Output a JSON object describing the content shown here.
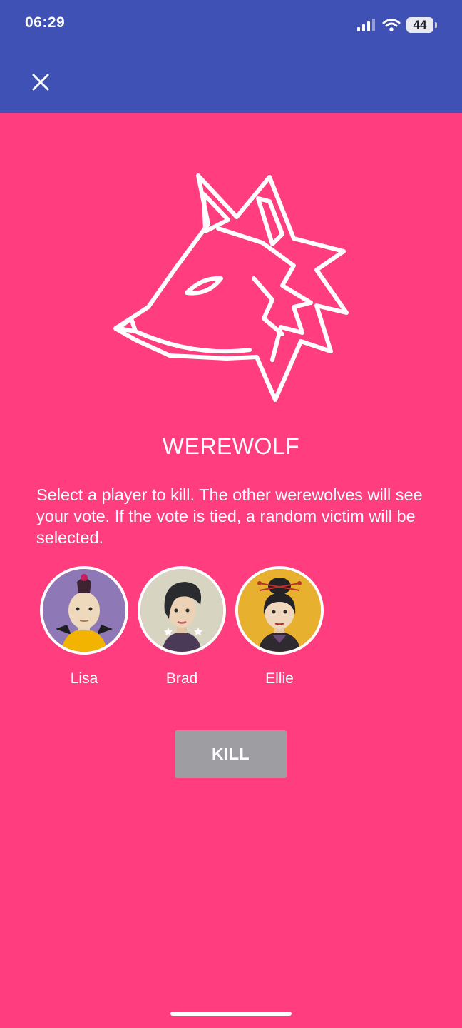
{
  "status_bar": {
    "time": "06:29",
    "battery": "44"
  },
  "header": {
    "close_icon": "close-icon"
  },
  "role": {
    "icon": "wolf-head-icon",
    "title": "WEREWOLF",
    "instructions": "Select a player to kill. The other werewolves will see your vote. If the vote is tied, a random victim will be selected."
  },
  "players": [
    {
      "name": "Lisa",
      "avatar": "avatar-lisa"
    },
    {
      "name": "Brad",
      "avatar": "avatar-brad"
    },
    {
      "name": "Ellie",
      "avatar": "avatar-ellie"
    }
  ],
  "actions": {
    "kill_label": "KILL"
  },
  "colors": {
    "header_bg": "#3f51b5",
    "page_bg": "#ff3d7f",
    "kill_button_bg": "#9e9ea2"
  }
}
